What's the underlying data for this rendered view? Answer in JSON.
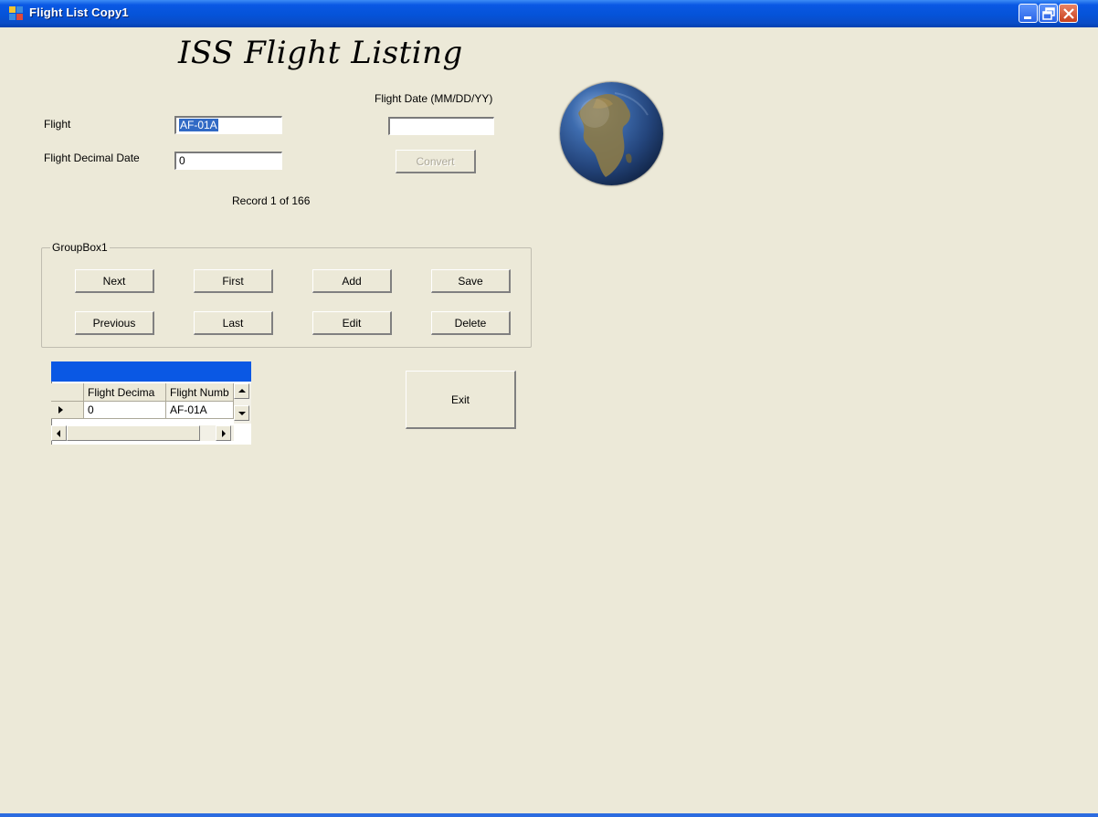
{
  "window": {
    "title": "Flight List Copy1"
  },
  "form": {
    "heading": "ISS Flight Listing",
    "flight_label": "Flight",
    "flight_value": "AF-01A",
    "decimal_date_label": "Flight Decimal Date",
    "decimal_date_value": "0",
    "flight_date_label": "Flight Date (MM/DD/YY)",
    "flight_date_value": "",
    "convert_label": "Convert",
    "record_status": "Record 1 of 166",
    "exit_label": "Exit"
  },
  "groupbox": {
    "title": "GroupBox1",
    "buttons": {
      "next": "Next",
      "first": "First",
      "add": "Add",
      "save": "Save",
      "previous": "Previous",
      "last": "Last",
      "edit": "Edit",
      "delete": "Delete"
    }
  },
  "grid": {
    "columns": [
      "Flight Decima",
      "Flight Numb"
    ],
    "rows": [
      [
        "0",
        "AF-01A"
      ]
    ]
  },
  "icons": {
    "globe": "globe-icon",
    "row_pointer": "row-pointer-icon"
  },
  "colors": {
    "titlebar": "#0a58e4",
    "window_bg": "#ece9d8",
    "selection": "#316ac5"
  }
}
